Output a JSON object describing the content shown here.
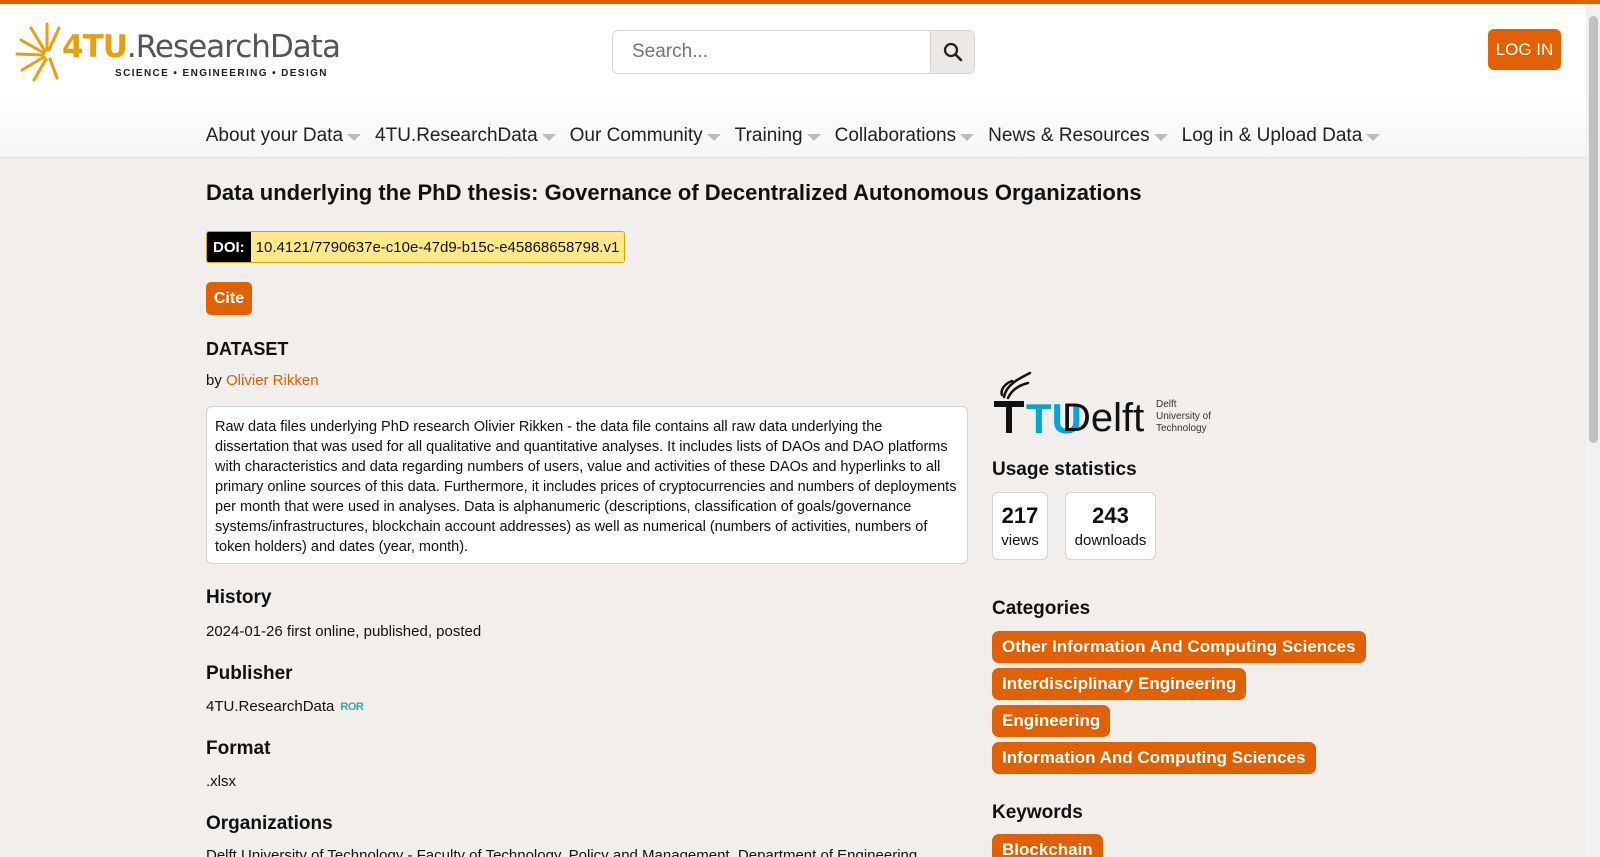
{
  "header": {
    "logo_main": "4TU",
    "logo_secondary": ".ResearchData",
    "logo_tagline": "SCIENCE • ENGINEERING • DESIGN",
    "search_placeholder": "Search...",
    "login_label": "LOG IN"
  },
  "nav": {
    "items": [
      {
        "label": "About your Data"
      },
      {
        "label": "4TU.ResearchData"
      },
      {
        "label": "Our Community"
      },
      {
        "label": "Training"
      },
      {
        "label": "Collaborations"
      },
      {
        "label": "News & Resources"
      },
      {
        "label": "Log in & Upload Data"
      }
    ]
  },
  "dataset": {
    "title": "Data underlying the PhD thesis: Governance of Decentralized Autonomous Organizations",
    "doi_label": "DOI:",
    "doi_value": "10.4121/7790637e-c10e-47d9-b15c-e45868658798.v1",
    "cite_label": "Cite",
    "type": "DATASET",
    "by_prefix": "by",
    "author": "Olivier Rikken",
    "description": "Raw data files underlying PhD research Olivier Rikken - the data file contains all raw data underlying the dissertation that was used for all qualitative and quantitative analyses. It includes lists of DAOs and DAO platforms with characteristics and data regarding numbers of users, value and activities of these DAOs and hyperlinks to all primary online sources of this data. Furthermore, it includes prices of cryptocurrencies and numbers of deployments per month that were used in analyses. Data is alphanumeric (descriptions, classification of goals/governance systems/infrastructures, blockchain account addresses) as well as numerical (numbers of activities, numbers of token holders) and dates (year, month).",
    "history_heading": "History",
    "history_value": "2024-01-26 first online, published, posted",
    "publisher_heading": "Publisher",
    "publisher_value": "4TU.ResearchData",
    "ror_label": "ROR",
    "format_heading": "Format",
    "format_value": ".xlsx",
    "organizations_heading": "Organizations",
    "organizations_value": "Delft University of Technology - Faculty of Technology, Policy and Management, Department of Engineering"
  },
  "sidebar": {
    "institution_logo_main": "Delft",
    "institution_logo_tu": "TU",
    "institution_logo_small": [
      "Delft",
      "University of",
      "Technology"
    ],
    "usage_heading": "Usage statistics",
    "views_count": "217",
    "views_label": "views",
    "downloads_count": "243",
    "downloads_label": "downloads",
    "categories_heading": "Categories",
    "categories": [
      "Other Information And Computing Sciences",
      "Interdisciplinary Engineering",
      "Engineering",
      "Information And Computing Sciences"
    ],
    "keywords_heading": "Keywords",
    "keywords": [
      "Blockchain"
    ]
  },
  "colors": {
    "accent": "#e16000",
    "logo_orange": "#e5a10e",
    "tu_blue": "#00a6d6",
    "doi_yellow": "#fde98a"
  }
}
